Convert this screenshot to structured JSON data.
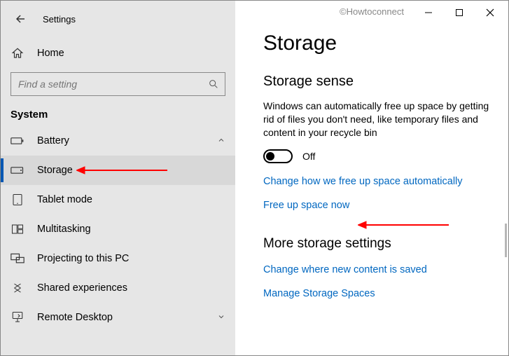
{
  "window": {
    "app_title": "Settings",
    "watermark": "©Howtoconnect"
  },
  "sidebar": {
    "home_label": "Home",
    "search_placeholder": "Find a setting",
    "section_label": "System",
    "items": [
      {
        "label": "Battery",
        "icon": "battery"
      },
      {
        "label": "Storage",
        "icon": "storage"
      },
      {
        "label": "Tablet mode",
        "icon": "tablet"
      },
      {
        "label": "Multitasking",
        "icon": "multitask"
      },
      {
        "label": "Projecting to this PC",
        "icon": "project"
      },
      {
        "label": "Shared experiences",
        "icon": "share"
      },
      {
        "label": "Remote Desktop",
        "icon": "remote"
      }
    ]
  },
  "content": {
    "title": "Storage",
    "sense_heading": "Storage sense",
    "sense_body": "Windows can automatically free up space by getting rid of files you don't need, like temporary files and content in your recycle bin",
    "toggle_state": "Off",
    "link_change": "Change how we free up space automatically",
    "link_freeup": "Free up space now",
    "more_heading": "More storage settings",
    "link_change_location": "Change where new content is saved",
    "link_manage_spaces": "Manage Storage Spaces"
  }
}
